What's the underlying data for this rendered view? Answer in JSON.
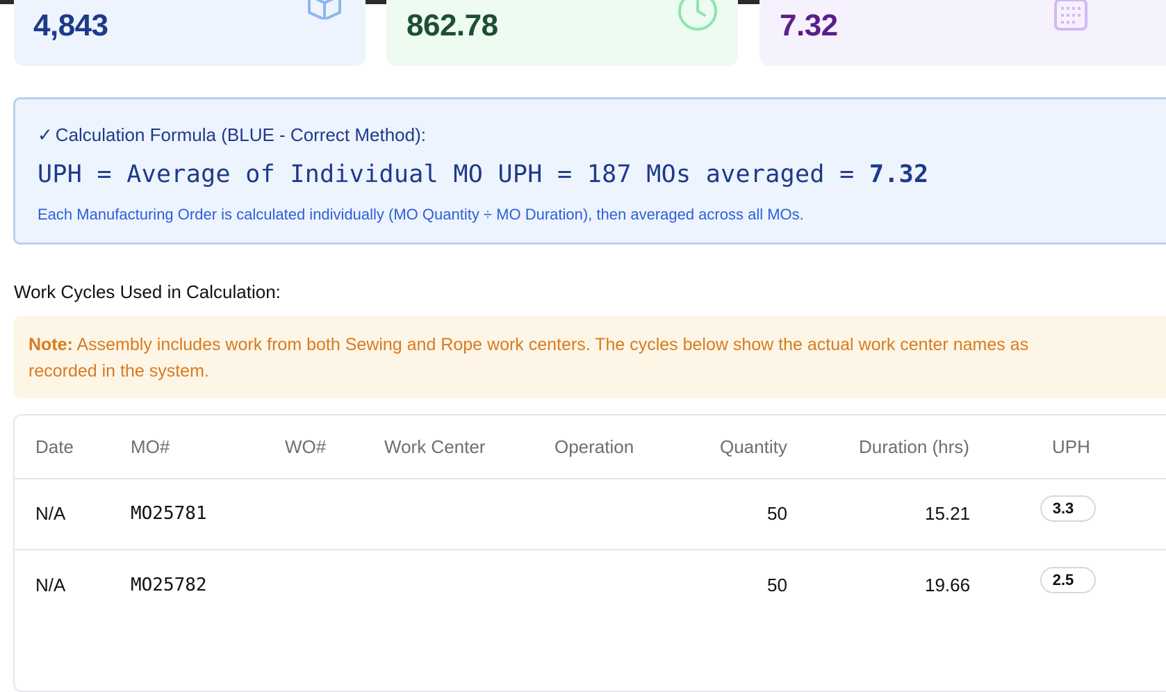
{
  "cards": [
    {
      "value": "4,843",
      "icon": "box-icon",
      "color": "#1e3a8a"
    },
    {
      "value": "862.78",
      "icon": "clock-icon",
      "color": "#1f4e32"
    },
    {
      "value": "7.32",
      "icon": "calendar-icon",
      "color": "#5b1f8a"
    }
  ],
  "formula": {
    "title_check": "✓",
    "title": "Calculation Formula (BLUE - Correct Method):",
    "equation": "UPH = Average of Individual MO UPH = 187 MOs averaged = ",
    "result": "7.32",
    "description": "Each Manufacturing Order is calculated individually (MO Quantity ÷ MO Duration), then averaged across all MOs."
  },
  "section_title": "Work Cycles Used in Calculation:",
  "note": {
    "label": "Note:",
    "text": " Assembly includes work from both Sewing and Rope work centers. The cycles below show the actual work center names as recorded in the system."
  },
  "table": {
    "headers": {
      "date": "Date",
      "mo": "MO#",
      "wo": "WO#",
      "work_center": "Work Center",
      "operation": "Operation",
      "quantity": "Quantity",
      "duration": "Duration (hrs)",
      "uph": "UPH"
    },
    "rows": [
      {
        "date": "N/A",
        "mo": "MO25781",
        "wo": "",
        "work_center": "",
        "operation": "",
        "quantity": "50",
        "duration": "15.21",
        "uph": "3.3"
      },
      {
        "date": "N/A",
        "mo": "MO25782",
        "wo": "",
        "work_center": "",
        "operation": "",
        "quantity": "50",
        "duration": "19.66",
        "uph": "2.5"
      }
    ]
  },
  "colors": {
    "accent_blue": "#1e3a8a",
    "note_orange": "#d97a1e",
    "formula_border": "#b8d0f2"
  }
}
